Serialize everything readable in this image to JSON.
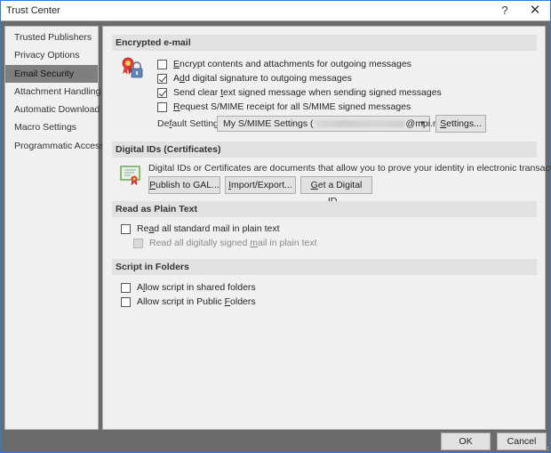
{
  "window": {
    "title": "Trust Center",
    "help_glyph": "?",
    "close_glyph": "✕"
  },
  "sidebar": {
    "items": [
      {
        "label": "Trusted Publishers",
        "active": false
      },
      {
        "label": "Privacy Options",
        "active": false
      },
      {
        "label": "Email Security",
        "active": true
      },
      {
        "label": "Attachment Handling",
        "active": false
      },
      {
        "label": "Automatic Download",
        "active": false
      },
      {
        "label": "Macro Settings",
        "active": false
      },
      {
        "label": "Programmatic Access",
        "active": false
      }
    ]
  },
  "encrypted": {
    "heading": "Encrypted e-mail",
    "icon": "certificate-lock-icon",
    "options": [
      {
        "pre": "",
        "accel": "E",
        "post": "ncrypt contents and attachments for outgoing messages",
        "checked": false
      },
      {
        "pre": "A",
        "accel": "d",
        "post": "d digital signature to outgoing messages",
        "checked": true
      },
      {
        "pre": "Send clear ",
        "accel": "t",
        "post": "ext signed message when sending signed messages",
        "checked": true
      },
      {
        "pre": "",
        "accel": "R",
        "post": "equest S/MIME receipt for all S/MIME signed messages",
        "checked": false
      }
    ],
    "default_setting_label_pre": "De",
    "default_setting_label_accel": "f",
    "default_setting_label_post": "ault Setting:",
    "default_setting_value_pre": "My S/MIME Settings (",
    "default_setting_value_post": "@mpi.nl)",
    "settings_pre": "",
    "settings_accel": "S",
    "settings_post": "ettings..."
  },
  "digital_ids": {
    "heading": "Digital IDs (Certificates)",
    "icon": "certificate-icon",
    "description": "Digital IDs or Certificates are documents that allow you to prove your identity in electronic transactions.",
    "buttons": [
      {
        "pre": "",
        "accel": "P",
        "post": "ublish to GAL..."
      },
      {
        "pre": "",
        "accel": "I",
        "post": "mport/Export..."
      },
      {
        "pre": "",
        "accel": "G",
        "post": "et a Digital ID..."
      }
    ]
  },
  "plain_text": {
    "heading": "Read as Plain Text",
    "options": [
      {
        "pre": "Re",
        "accel": "a",
        "post": "d all standard mail in plain text",
        "checked": false,
        "disabled": false
      },
      {
        "pre": "Read all digitally signed ",
        "accel": "m",
        "post": "ail in plain text",
        "checked": false,
        "disabled": true
      }
    ]
  },
  "script": {
    "heading": "Script in Folders",
    "options": [
      {
        "pre": "A",
        "accel": "l",
        "post": "low script in shared folders",
        "checked": false
      },
      {
        "pre": "Allow script in Public ",
        "accel": "F",
        "post": "olders",
        "checked": false
      }
    ]
  },
  "footer": {
    "ok_label": "OK",
    "cancel_label": "Cancel"
  }
}
